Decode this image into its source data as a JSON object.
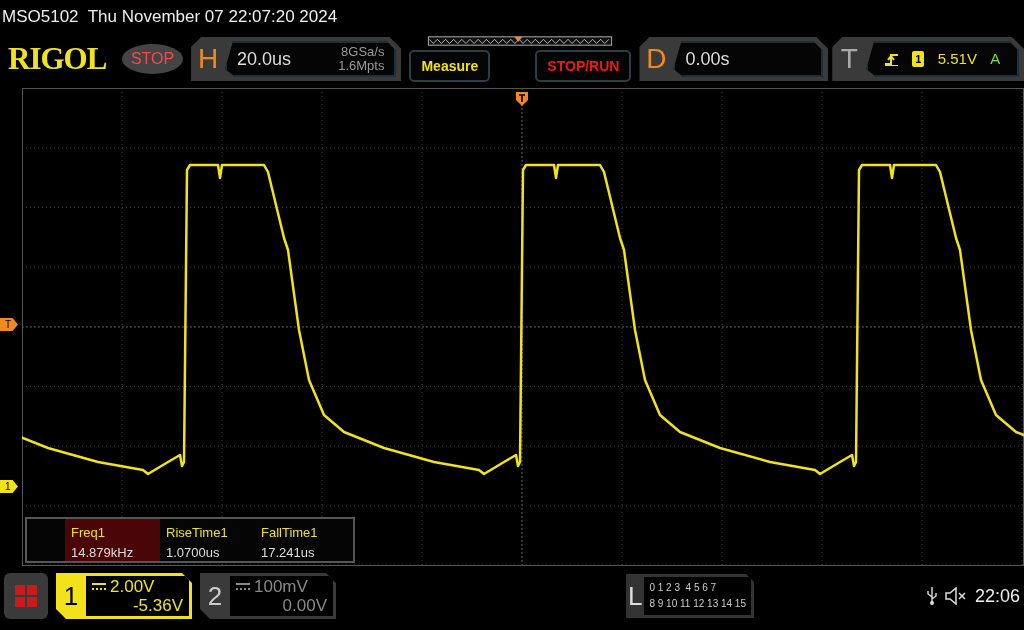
{
  "header": {
    "model": "MSO5102",
    "datetime": "Thu November 07 22:07:20 2024"
  },
  "toolbar": {
    "logo": "RIGOL",
    "run_state": {
      "label": "STOP",
      "kind": "stop"
    },
    "horizontal": {
      "letter": "H",
      "timebase": "20.0us",
      "sample_rate": "8GSa/s",
      "memory_depth": "1.6Mpts"
    },
    "buttons": [
      {
        "label": "Measure",
        "kind": "measure"
      },
      {
        "label": "STOP/RUN",
        "kind": "run"
      }
    ],
    "delay": {
      "letter": "D",
      "value": "0.00s"
    },
    "trigger": {
      "letter": "T",
      "source": "1",
      "level": "5.51V",
      "mode": "A"
    }
  },
  "graticule": {
    "markers": [
      {
        "label": "T",
        "kind": "trigger"
      },
      {
        "label": "1",
        "kind": "channel"
      }
    ]
  },
  "measurements": [
    {
      "name": "Freq1",
      "value": "14.879kHz",
      "selected": true
    },
    {
      "name": "RiseTime1",
      "value": "1.0700us",
      "selected": false
    },
    {
      "name": "FallTime1",
      "value": "17.241us",
      "selected": false
    }
  ],
  "channels": [
    {
      "number": "1",
      "scale": "2.00V",
      "offset": "-5.36V",
      "selected": true
    },
    {
      "number": "2",
      "scale": "100mV",
      "offset": "0.00V",
      "selected": false
    }
  ],
  "logic": {
    "letter": "L",
    "rows": [
      "0 1 2 3  4 5 6 7",
      "8 9 10 11 12 13 14 15"
    ]
  },
  "status": {
    "muted": true,
    "time": "22:06"
  }
}
